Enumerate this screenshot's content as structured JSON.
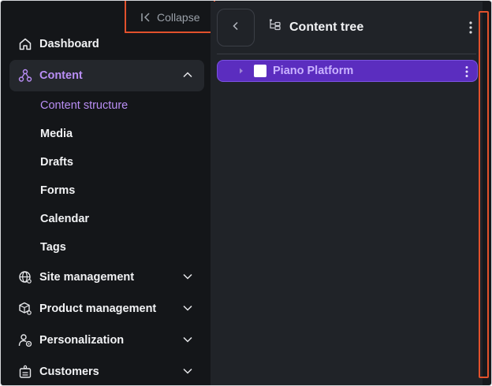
{
  "sidebar": {
    "collapse_label": "Collapse",
    "items": [
      {
        "label": "Dashboard",
        "icon": "home-icon"
      },
      {
        "label": "Content",
        "icon": "content-icon",
        "expanded": true,
        "active": true
      },
      {
        "label": "Site management",
        "icon": "globe-icon"
      },
      {
        "label": "Product management",
        "icon": "product-icon"
      },
      {
        "label": "Personalization",
        "icon": "personalization-icon"
      },
      {
        "label": "Customers",
        "icon": "customers-icon"
      }
    ],
    "content_subitems": [
      {
        "label": "Content structure",
        "active": true
      },
      {
        "label": "Media"
      },
      {
        "label": "Drafts"
      },
      {
        "label": "Forms"
      },
      {
        "label": "Calendar"
      },
      {
        "label": "Tags"
      }
    ]
  },
  "panel": {
    "title": "Content tree",
    "title_icon": "tree-icon",
    "tree": [
      {
        "label": "Piano Platform",
        "selected": true
      }
    ]
  },
  "colors": {
    "accent": "#b98ef5",
    "selection": "#5b2dbf",
    "highlight_outline": "#e2512c",
    "sidebar_bg": "#141619",
    "panel_bg": "#202328"
  }
}
